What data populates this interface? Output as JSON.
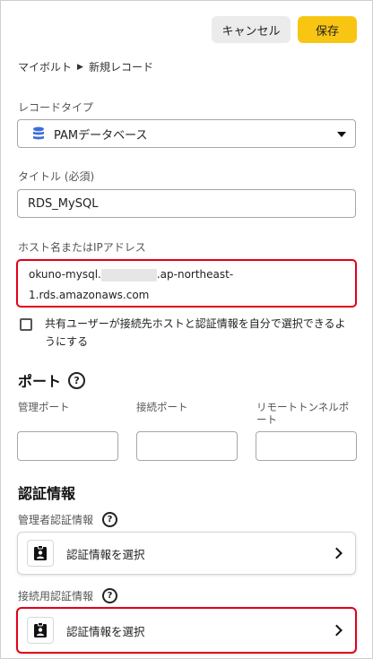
{
  "toolbar": {
    "cancel_label": "キャンセル",
    "save_label": "保存"
  },
  "breadcrumb": {
    "parent": "マイボルト",
    "current": "新規レコード"
  },
  "record_type": {
    "label": "レコードタイプ",
    "value": "PAMデータベース",
    "icon": "database-icon"
  },
  "title_field": {
    "label": "タイトル (必須)",
    "value": "RDS_MySQL"
  },
  "host_field": {
    "label": "ホスト名またはIPアドレス",
    "value_prefix": "okuno-mysql.",
    "value_suffix": ".ap-northeast-",
    "value_line2": "1.rds.amazonaws.com"
  },
  "share_checkbox": {
    "label": "共有ユーザーが接続先ホストと認証情報を自分で選択できるようにする",
    "checked": false
  },
  "ports": {
    "title": "ポート",
    "admin_label": "管理ポート",
    "connection_label": "接続ポート",
    "tunnel_label": "リモートトンネルポート",
    "admin_value": "",
    "connection_value": "",
    "tunnel_value": ""
  },
  "credentials": {
    "title": "認証情報",
    "admin_label": "管理者認証情報",
    "admin_button": "認証情報を選択",
    "connection_label": "接続用認証情報",
    "connection_button": "認証情報を選択"
  },
  "colors": {
    "save": "#f9c513",
    "highlight": "#e0001a",
    "db_icon": "#3b6fd9"
  }
}
